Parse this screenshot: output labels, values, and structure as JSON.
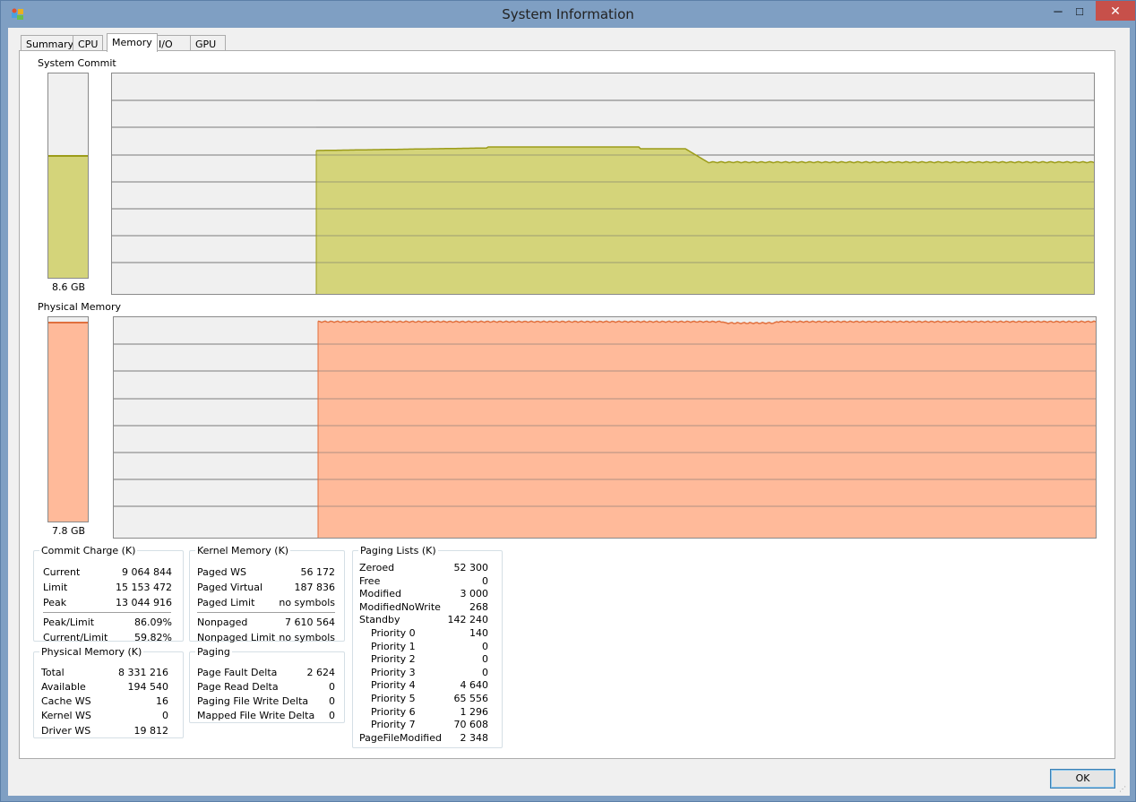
{
  "window": {
    "title": "System Information",
    "icon": "process-explorer-icon",
    "controls": {
      "minimize": "─",
      "maximize": "□",
      "close": "✕"
    }
  },
  "tabs": [
    {
      "label": "Summary",
      "active": false
    },
    {
      "label": "CPU",
      "active": false
    },
    {
      "label": "Memory",
      "active": true
    },
    {
      "label": "I/O",
      "active": false
    },
    {
      "label": "GPU",
      "active": false
    }
  ],
  "system_commit": {
    "label": "System Commit",
    "meter_value": "8.6 GB",
    "meter_fraction": 0.6,
    "color": "#d4d47a",
    "line_color": "#9c9c1a"
  },
  "physical_memory_graph": {
    "label": "Physical Memory",
    "meter_value": "7.8 GB",
    "meter_fraction": 0.98,
    "color": "#ffba9a",
    "line_color": "#e0703e"
  },
  "commit_charge": {
    "title": "Commit Charge (K)",
    "rows": [
      {
        "key": "Current",
        "value": "9 064 844"
      },
      {
        "key": "Limit",
        "value": "15 153 472"
      },
      {
        "key": "Peak",
        "value": "13 044 916"
      }
    ],
    "ratios": [
      {
        "key": "Peak/Limit",
        "value": "86.09%"
      },
      {
        "key": "Current/Limit",
        "value": "59.82%"
      }
    ]
  },
  "physical_memory": {
    "title": "Physical Memory (K)",
    "rows": [
      {
        "key": "Total",
        "value": "8 331 216"
      },
      {
        "key": "Available",
        "value": "194 540"
      },
      {
        "key": "Cache WS",
        "value": "16"
      },
      {
        "key": "Kernel WS",
        "value": "0"
      },
      {
        "key": "Driver WS",
        "value": "19 812"
      }
    ]
  },
  "kernel_memory": {
    "title": "Kernel Memory (K)",
    "rows": [
      {
        "key": "Paged WS",
        "value": "56 172"
      },
      {
        "key": "Paged Virtual",
        "value": "187 836"
      },
      {
        "key": "Paged Limit",
        "value": "no symbols"
      }
    ],
    "nonpaged": [
      {
        "key": "Nonpaged",
        "value": "7 610 564"
      },
      {
        "key": "Nonpaged Limit",
        "value": "no symbols"
      }
    ]
  },
  "paging": {
    "title": "Paging",
    "rows": [
      {
        "key": "Page Fault Delta",
        "value": "2 624"
      },
      {
        "key": "Page Read Delta",
        "value": "0"
      },
      {
        "key": "Paging File Write Delta",
        "value": "0"
      },
      {
        "key": "Mapped File Write Delta",
        "value": "0"
      }
    ]
  },
  "paging_lists": {
    "title": "Paging Lists (K)",
    "rows": [
      {
        "key": "Zeroed",
        "value": "52 300",
        "indent": false
      },
      {
        "key": "Free",
        "value": "0",
        "indent": false
      },
      {
        "key": "Modified",
        "value": "3 000",
        "indent": false
      },
      {
        "key": "ModifiedNoWrite",
        "value": "268",
        "indent": false
      },
      {
        "key": "Standby",
        "value": "142 240",
        "indent": false
      },
      {
        "key": "Priority 0",
        "value": "140",
        "indent": true
      },
      {
        "key": "Priority 1",
        "value": "0",
        "indent": true
      },
      {
        "key": "Priority 2",
        "value": "0",
        "indent": true
      },
      {
        "key": "Priority 3",
        "value": "0",
        "indent": true
      },
      {
        "key": "Priority 4",
        "value": "4 640",
        "indent": true
      },
      {
        "key": "Priority 5",
        "value": "65 556",
        "indent": true
      },
      {
        "key": "Priority 6",
        "value": "1 296",
        "indent": true
      },
      {
        "key": "Priority 7",
        "value": "70 608",
        "indent": true
      },
      {
        "key": "PageFileModified",
        "value": "2 348",
        "indent": false
      }
    ]
  },
  "buttons": {
    "ok": "OK"
  }
}
